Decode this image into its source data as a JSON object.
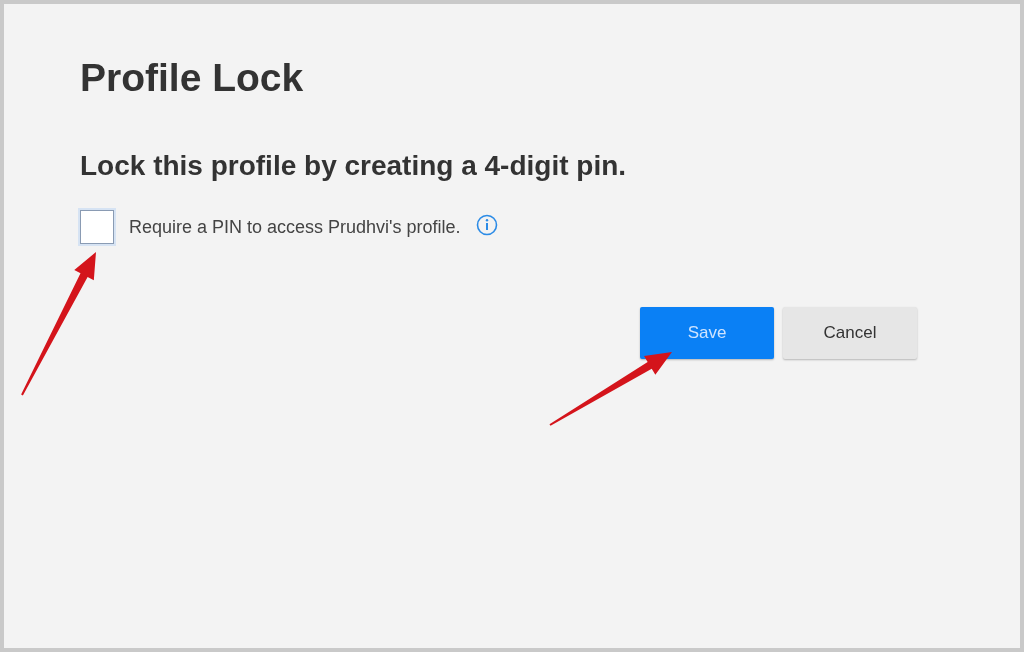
{
  "title": "Profile Lock",
  "subtitle": "Lock this profile by creating a 4-digit pin.",
  "pin_option": {
    "label": "Require a PIN to access Prudhvi's profile.",
    "checked": false
  },
  "buttons": [
    {
      "label": "Save",
      "kind": "primary"
    },
    {
      "label": "Cancel",
      "kind": "secondary"
    }
  ]
}
